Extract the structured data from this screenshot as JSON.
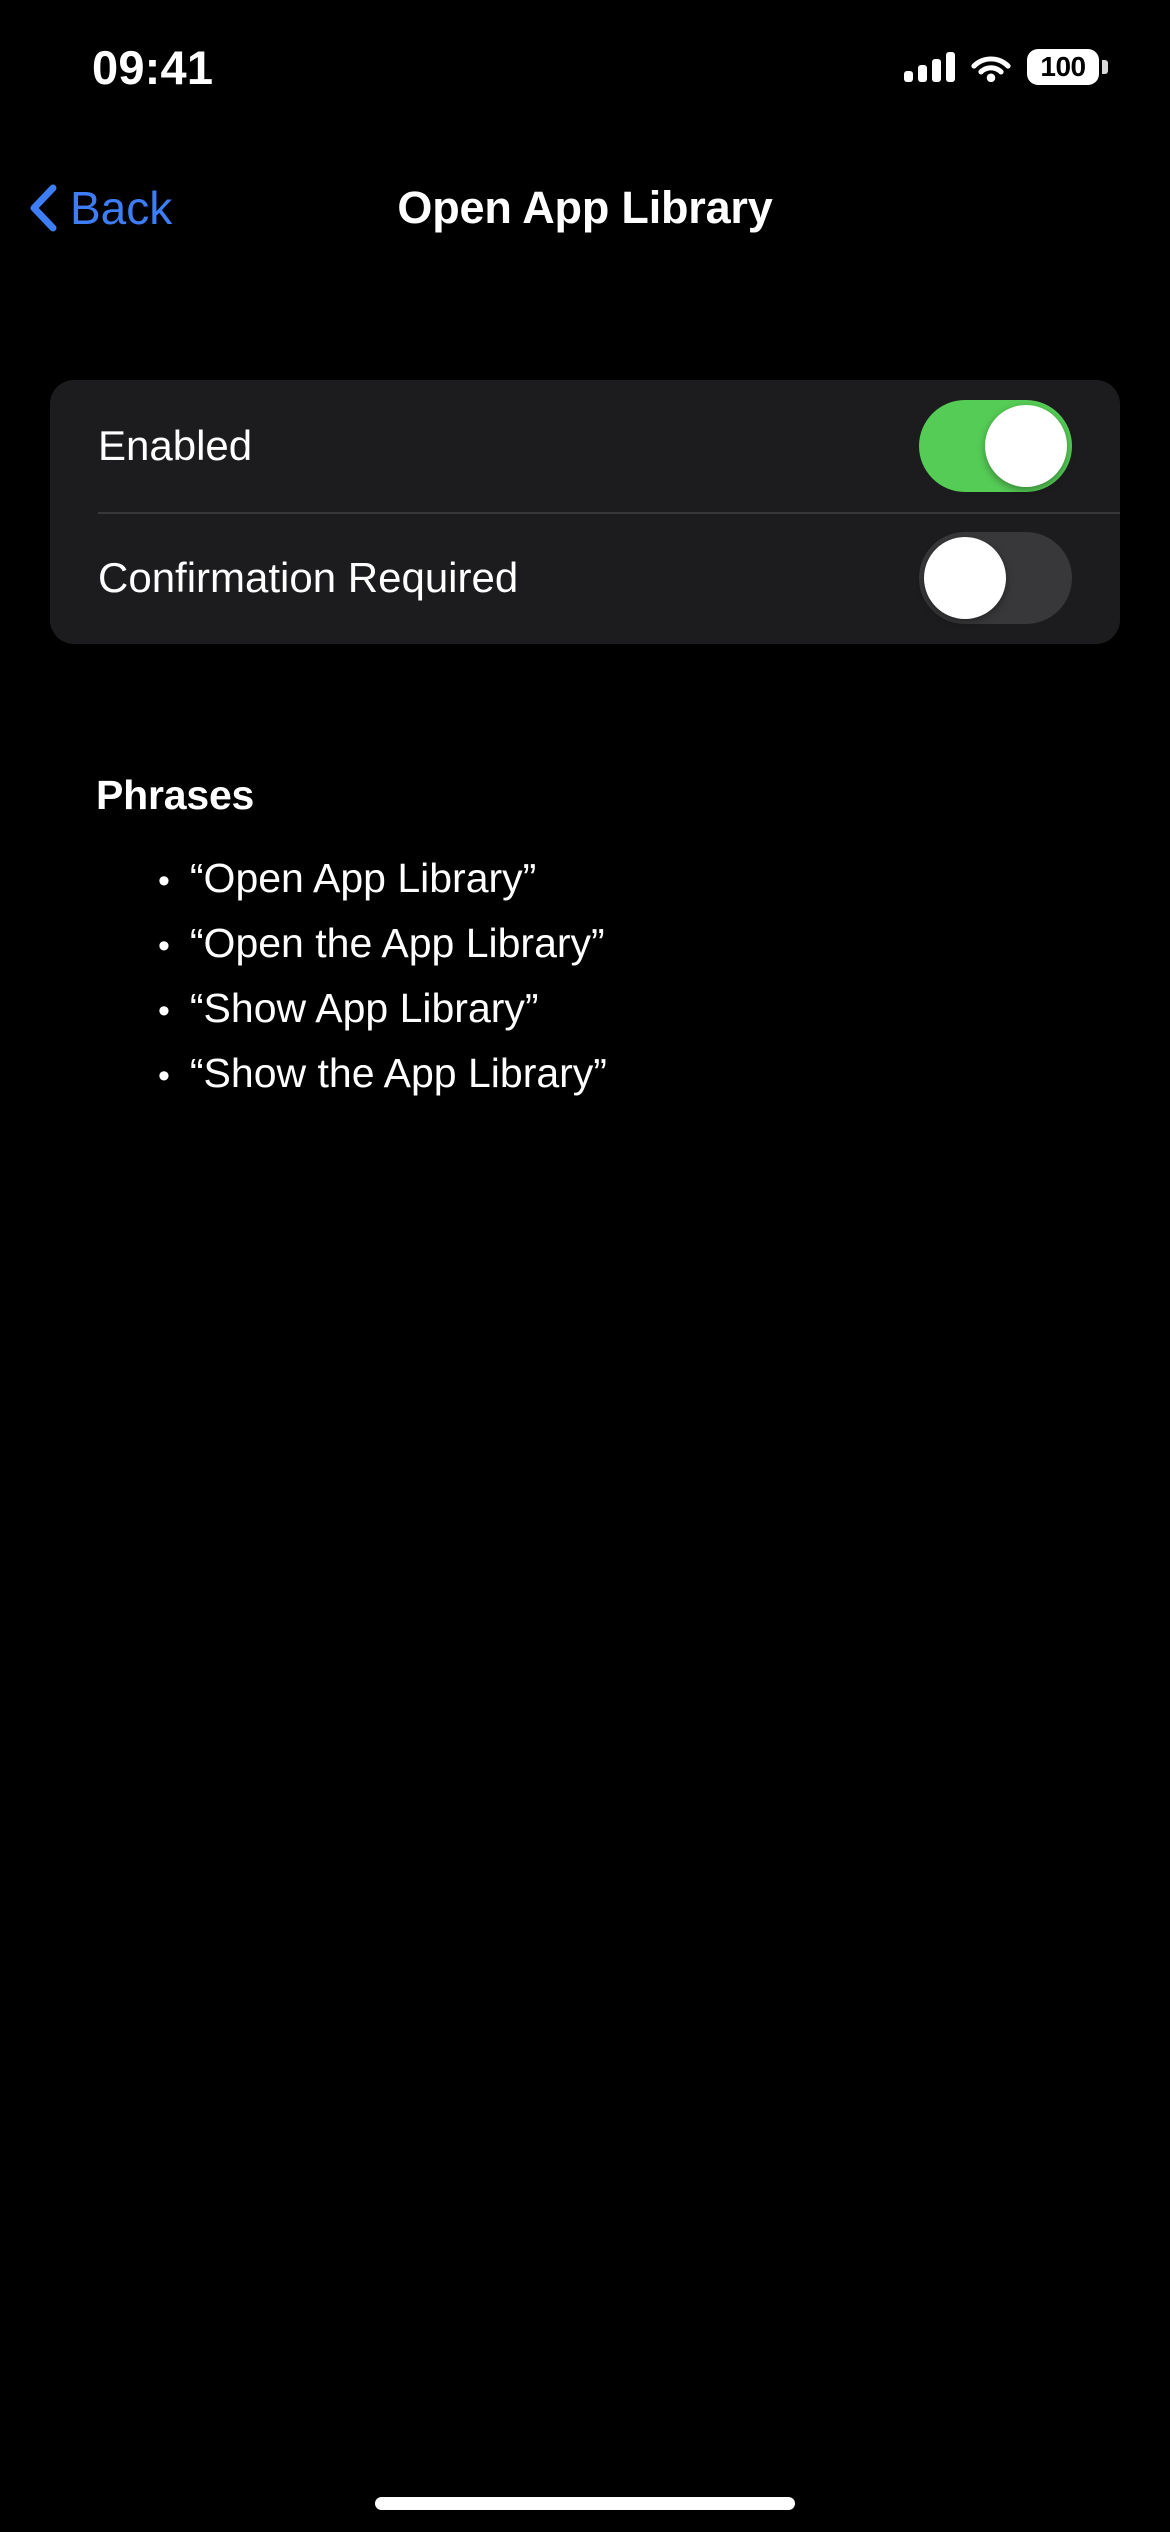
{
  "status_bar": {
    "time": "09:41",
    "signal_icon": "cellular-signal-icon",
    "wifi_icon": "wifi-icon",
    "battery_level": "100",
    "battery_icon": "battery-icon"
  },
  "nav_bar": {
    "back_label": "Back",
    "back_icon": "chevron-left-icon",
    "title": "Open App Library"
  },
  "settings": {
    "rows": [
      {
        "label": "Enabled",
        "state": "on"
      },
      {
        "label": "Confirmation Required",
        "state": "off"
      }
    ]
  },
  "phrases": {
    "heading": "Phrases",
    "bullet": "•",
    "items": [
      "“Open App Library”",
      "“Open the App Library”",
      "“Show App Library”",
      "“Show the App Library”"
    ]
  },
  "colors": {
    "background": "#000000",
    "card": "#1C1C1E",
    "accent_blue": "#3D7DF6",
    "toggle_on": "#55CC55",
    "toggle_off": "#38383A",
    "separator": "#38383A"
  }
}
